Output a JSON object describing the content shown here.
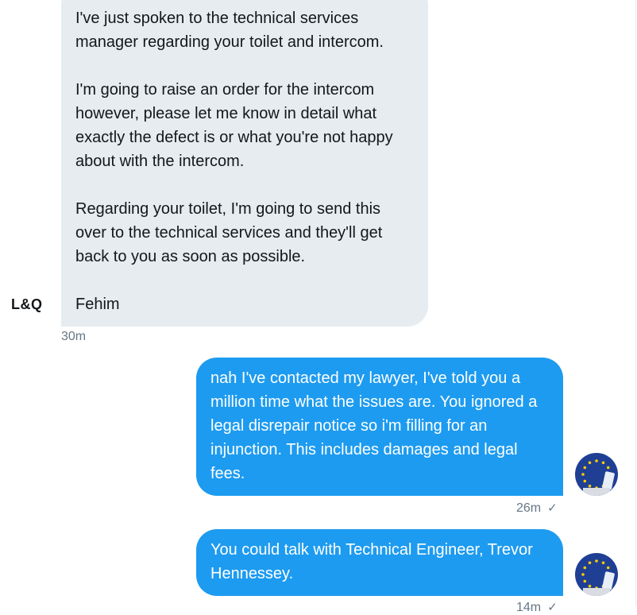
{
  "brand_logo_text": "L&Q",
  "messages": [
    {
      "text": "I've just spoken to the technical services manager regarding your toilet and intercom.\n\nI'm going to raise an order for the intercom however, please let me know in detail what exactly the defect is or what you're not happy about with the intercom.\n\nRegarding your toilet, I'm going to send this over to the technical services and they'll get back to you as soon as possible.\n\nFehim",
      "time": "30m"
    },
    {
      "text": "nah I've contacted my lawyer, I've told you a million time what the issues are. You ignored a legal disrepair notice so i'm filling for an injunction. This includes damages and legal fees.",
      "time": "26m"
    },
    {
      "text": "You could talk with Technical Engineer, Trevor Hennessey.",
      "time": "14m"
    }
  ],
  "icons": {
    "sent_check": "✓",
    "user_avatar": "eu-flag-avatar-icon"
  },
  "colors": {
    "incoming_bubble": "#e6ecf0",
    "outgoing_bubble": "#1d9bf0",
    "meta_text": "#657786"
  }
}
